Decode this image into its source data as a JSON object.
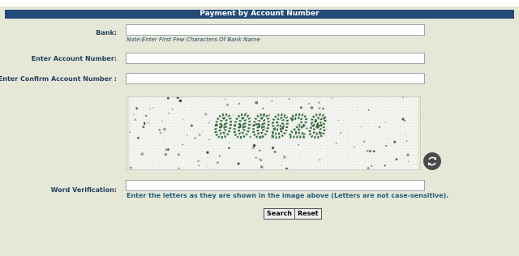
{
  "form": {
    "title": "Payment by Account Number",
    "bank_label": "Bank:",
    "bank_value": "",
    "bank_note": "Note:Enter First Few Characters Of Bank Name",
    "account_label": "Enter Account Number:",
    "account_value": "",
    "confirm_label": "Enter Confirm Account Number :",
    "confirm_value": "",
    "captcha_text": "000928",
    "verification_label": "Word Verification:",
    "verification_value": "",
    "verification_hint": "Enter the letters as they are shown in the image above (Letters are not case-sensitive).",
    "search_label": "Search",
    "reset_label": "Reset"
  },
  "icons": {
    "refresh": "refresh-icon"
  },
  "colors": {
    "title_bar": "#234a78",
    "page_bg": "#e6e8d7",
    "label": "#1f3d5c",
    "captcha_digits": "#2e6b3a"
  }
}
